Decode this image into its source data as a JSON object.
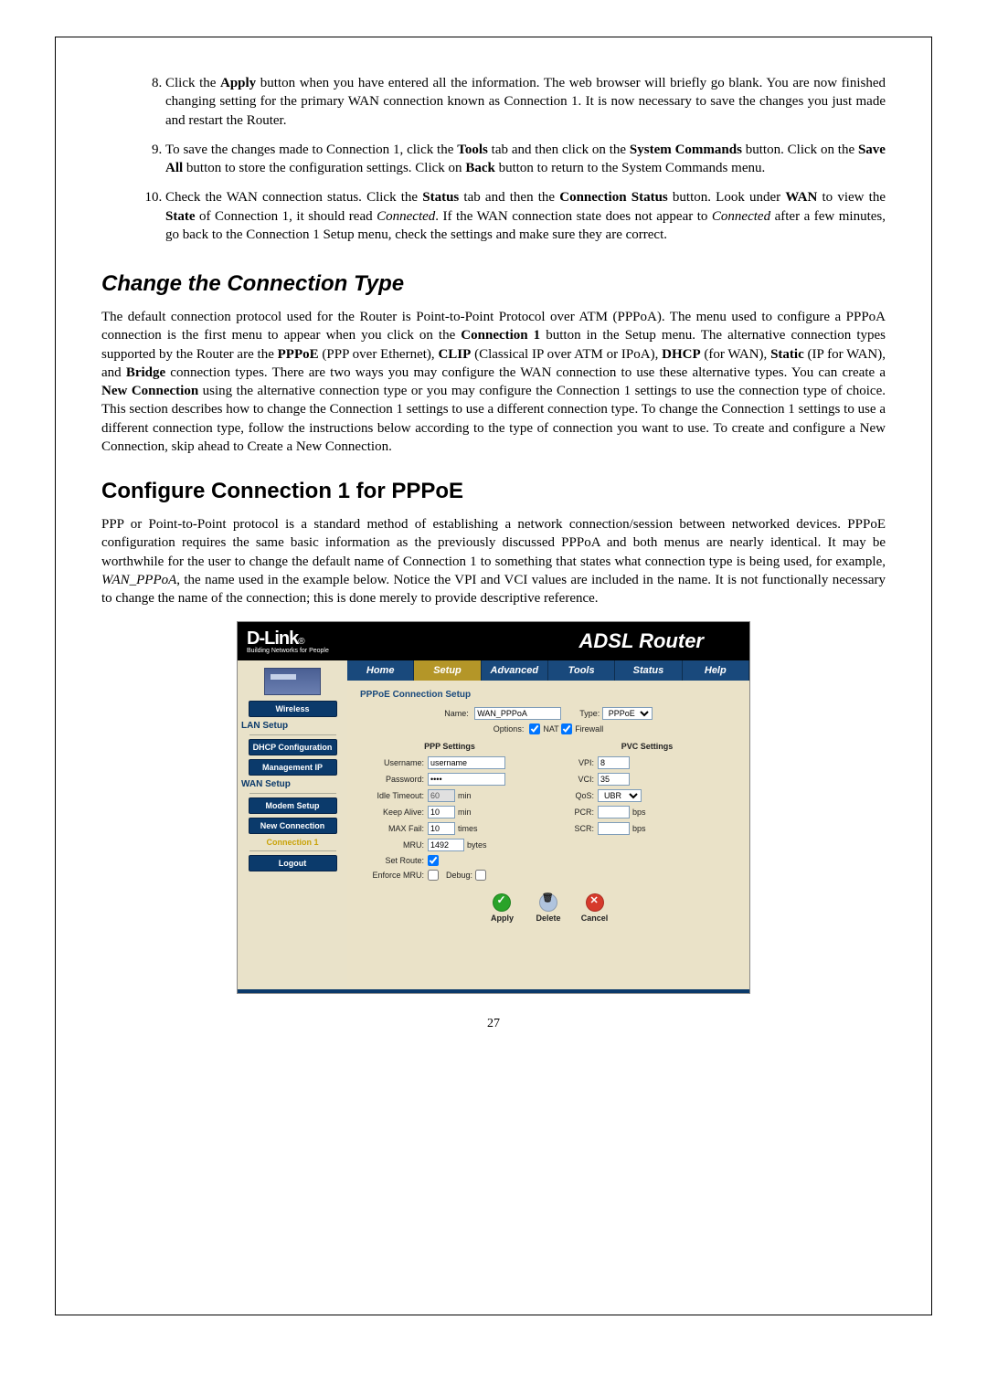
{
  "page_number": "27",
  "instructions": {
    "start": 8,
    "items": [
      "Click the <b>Apply</b> button when you have entered all the information. The web browser will briefly go blank. You are now finished changing setting for the primary WAN connection known as Connection 1. It is now necessary to save the changes you just made and restart the Router.",
      "To save the changes made to Connection 1, click the <b>Tools</b> tab and then click on the <b>System Commands</b> button. Click on the <b>Save All</b> button to store the configuration settings. Click on <b>Back</b> button to return to the System Commands menu.",
      "Check the WAN connection status. Click the <b>Status</b> tab and then the <b>Connection Status</b> button. Look under <b>WAN</b> to view the <b>State</b> of Connection 1, it should read <i>Connected</i>. If the WAN connection state does not appear to <i>Connected</i> after a few minutes, go back to the Connection 1 Setup menu, check the settings and make sure they are correct."
    ]
  },
  "heading_change": "Change the Connection Type",
  "para_change": "The default connection protocol used for the Router is Point-to-Point Protocol over ATM (PPPoA). The menu used to configure a PPPoA connection is the first menu to appear when you click on the <b>Connection 1</b> button in the Setup menu. The alternative connection types supported by the Router are the <b>PPPoE</b> (PPP over Ethernet), <b>CLIP</b> (Classical IP over ATM or IPoA), <b>DHCP</b> (for WAN), <b>Static</b> (IP for WAN), and <b>Bridge</b> connection types. There are two ways you may configure the WAN connection to use these alternative types. You can create a <b>New Connection</b> using the alternative connection type or you may configure the Connection 1 settings to use the connection type of choice. This section describes how to change the Connection 1 settings to use a different connection type. To change the Connection 1 settings to use a different connection type, follow the instructions below according to the type of connection you want to use. To create and configure a New Connection, skip ahead to Create a New Connection.",
  "heading_pppoe": "Configure Connection 1 for PPPoE",
  "para_pppoe": "PPP or Point-to-Point protocol is a standard method of establishing a network connection/session between networked devices. PPPoE configuration requires the same basic information as the previously discussed PPPoA and both menus are nearly identical. It may be worthwhile for the user to change the default name of Connection 1 to something that states what connection type is being used, for example, <i>WAN_PPPoA</i>, the name used in the example below. Notice the VPI and VCI values are included in the name. It is not functionally necessary to change the name of the connection; this is done merely to provide descriptive reference.",
  "router": {
    "brand": "D-Link",
    "tagline": "Building Networks for People",
    "title": "ADSL Router",
    "tabs": [
      "Home",
      "Setup",
      "Advanced",
      "Tools",
      "Status",
      "Help"
    ],
    "active_tab": "Setup",
    "sidebar": {
      "wireless": "Wireless",
      "lansetup": "LAN Setup",
      "dhcp": "DHCP Configuration",
      "mgmtip": "Management IP",
      "wansetup": "WAN Setup",
      "modem": "Modem Setup",
      "newconn": "New Connection",
      "conn1": "Connection 1",
      "logout": "Logout"
    },
    "section": "PPPoE Connection Setup",
    "name_label": "Name:",
    "name_value": "WAN_PPPoA",
    "type_label": "Type:",
    "type_value": "PPPoE",
    "options_label": "Options:",
    "opt_nat": "NAT",
    "opt_firewall": "Firewall",
    "ppp_heading": "PPP Settings",
    "pvc_heading": "PVC Settings",
    "ppp": {
      "username_l": "Username:",
      "username_v": "username",
      "password_l": "Password:",
      "password_v": "••••",
      "idle_l": "Idle Timeout:",
      "idle_v": "60",
      "idle_u": "min",
      "keep_l": "Keep Alive:",
      "keep_v": "10",
      "keep_u": "min",
      "maxfail_l": "MAX Fail:",
      "maxfail_v": "10",
      "maxfail_u": "times",
      "mru_l": "MRU:",
      "mru_v": "1492",
      "mru_u": "bytes",
      "setroute_l": "Set Route:",
      "enforce_l": "Enforce MRU:",
      "debug_l": "Debug:"
    },
    "pvc": {
      "vpi_l": "VPI:",
      "vpi_v": "8",
      "vci_l": "VCI:",
      "vci_v": "35",
      "qos_l": "QoS:",
      "qos_v": "UBR",
      "pcr_l": "PCR:",
      "pcr_v": "",
      "pcr_u": "bps",
      "scr_l": "SCR:",
      "scr_v": "",
      "scr_u": "bps"
    },
    "actions": {
      "apply": "Apply",
      "delete": "Delete",
      "cancel": "Cancel"
    }
  }
}
